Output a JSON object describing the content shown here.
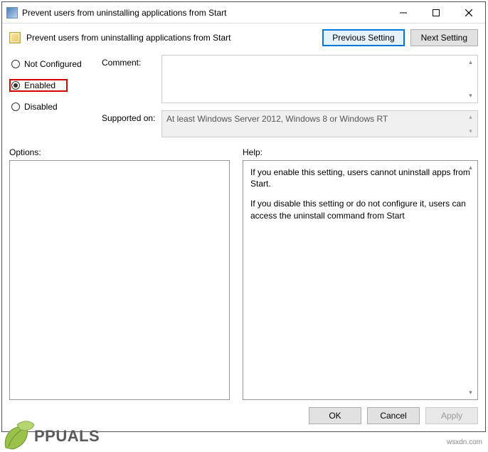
{
  "window": {
    "title": "Prevent users from uninstalling applications from Start"
  },
  "header": {
    "policy_title": "Prevent users from uninstalling applications from Start",
    "prev_setting": "Previous Setting",
    "next_setting": "Next Setting"
  },
  "radios": {
    "not_configured": "Not Configured",
    "enabled": "Enabled",
    "disabled": "Disabled",
    "selected": "enabled"
  },
  "labels": {
    "comment": "Comment:",
    "supported_on": "Supported on:",
    "options": "Options:",
    "help": "Help:"
  },
  "supported_text": "At least Windows Server 2012, Windows 8 or Windows RT",
  "help_text": {
    "p1": "If you enable this setting, users cannot uninstall apps from Start.",
    "p2": "If you disable this setting or do not configure it, users can access the uninstall command from Start"
  },
  "buttons": {
    "ok": "OK",
    "cancel": "Cancel",
    "apply": "Apply"
  },
  "watermark": "wsxdn.com",
  "brand": "PPUALS"
}
